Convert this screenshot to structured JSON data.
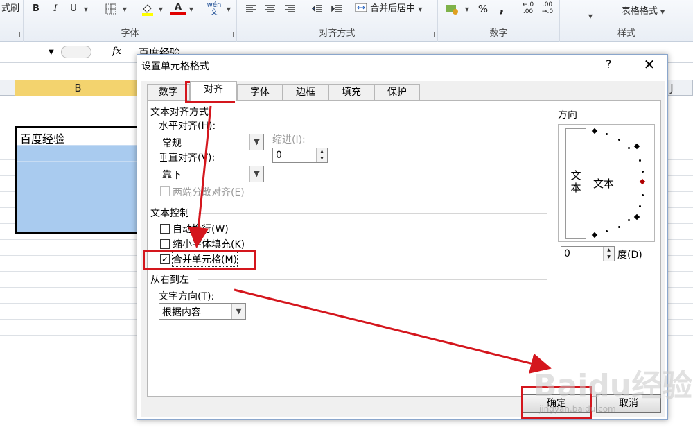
{
  "ribbon": {
    "left_cut_label": "式刷",
    "bold": "B",
    "italic": "I",
    "underline": "U",
    "font_color_glyph": "A",
    "wen_glyph": "wén\n文",
    "merge_center_label": "合并后居中",
    "percent_glyph": "%",
    "comma_glyph": ",",
    "table_format_label": "表格格式",
    "groups": {
      "font": "字体",
      "alignment": "对齐方式",
      "number": "数字",
      "styles": "样式"
    }
  },
  "formula_bar": {
    "fx": "fx",
    "content": "百度经验"
  },
  "sheet": {
    "columns": {
      "B": "B",
      "J": "J"
    },
    "merged_cell_text": "百度经验"
  },
  "dialog": {
    "title": "设置单元格格式",
    "help": "?",
    "close": "✕",
    "tabs": [
      "数字",
      "对齐",
      "字体",
      "边框",
      "填充",
      "保护"
    ],
    "active_tab": "对齐",
    "text_alignment": {
      "section": "文本对齐方式",
      "horizontal_label": "水平对齐(H):",
      "horizontal_value": "常规",
      "indent_label": "缩进(I):",
      "indent_value": "0",
      "vertical_label": "垂直对齐(V):",
      "vertical_value": "靠下",
      "justify_distributed": "两端分散对齐(E)"
    },
    "text_control": {
      "section": "文本控制",
      "wrap_text": "自动换行(W)",
      "shrink_to_fit": "缩小字体填充(K)",
      "merge_cells": "合并单元格(M)",
      "merge_checked": true
    },
    "right_to_left": {
      "section": "从右到左",
      "direction_label": "文字方向(T):",
      "direction_value": "根据内容"
    },
    "orientation": {
      "section": "方向",
      "vertical_text": "文\n本",
      "text_label": "文本",
      "degrees_value": "0",
      "degrees_label": "度(D)"
    },
    "ok": "确定",
    "cancel": "取消"
  },
  "watermark": {
    "text": "Baidu经验",
    "sub": "jingyan.baidu.com"
  },
  "annotation_color": "#d4161d"
}
